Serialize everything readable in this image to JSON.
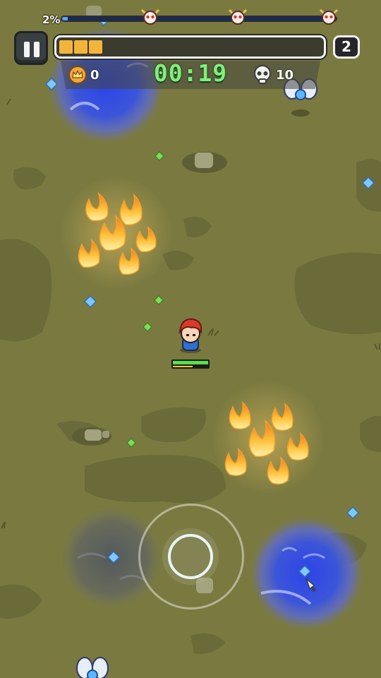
{
  "hud": {
    "wave_progress_label": "2%",
    "wave_progress": 0.02,
    "boss_markers": [
      "boss-skull-icon",
      "boss-skull-icon",
      "boss-skull-icon"
    ],
    "pause_icon": "pause-icon",
    "xp_segments_filled": 3,
    "level": "2",
    "coins": "0",
    "timer": "00:19",
    "kills": "10",
    "coin_icon": "crown-coin-icon",
    "kill_icon": "skull-icon"
  },
  "player": {
    "hp_fraction": 1.0,
    "xp_fraction": 0.55
  },
  "colors": {
    "ground": "#7a7a40",
    "timer": "#7ef07b",
    "xp": "#f3b43c",
    "hp": "#58e04c",
    "water": "#3c4fd8",
    "fire": "#ffb12e"
  }
}
